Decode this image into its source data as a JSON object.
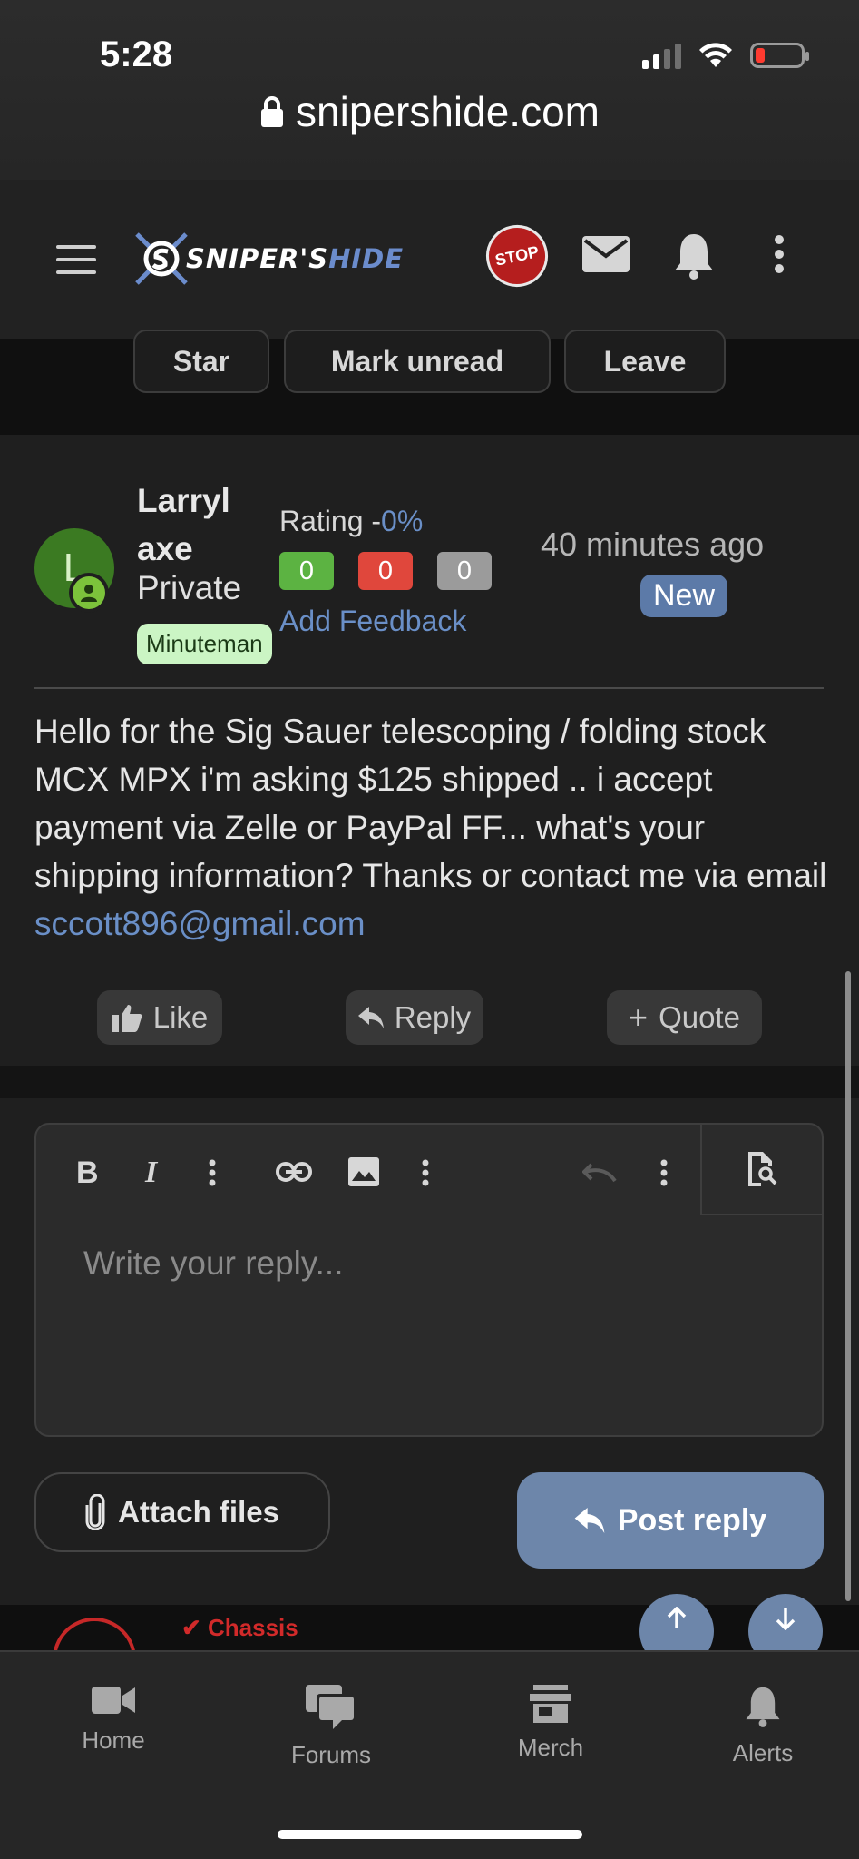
{
  "status_bar": {
    "time": "5:28"
  },
  "browser": {
    "url": "snipershide.com"
  },
  "header": {
    "logo_main": "SNIPER'S",
    "logo_accent": "HIDE",
    "stop_sign": "STOP"
  },
  "thread_actions": [
    {
      "label": "Star"
    },
    {
      "label": "Mark unread"
    },
    {
      "label": "Leave"
    }
  ],
  "post": {
    "avatar_letter": "L",
    "username": "Larryl axe",
    "user_title": "Private",
    "user_badge": "Minuteman",
    "rating_label": "Rating -",
    "rating_value": "0%",
    "rating_positive": "0",
    "rating_negative": "0",
    "rating_neutral": "0",
    "add_feedback": "Add Feedback",
    "time": "40 minutes ago",
    "new_badge": "New",
    "body_text": "Hello for the Sig Sauer telescoping / folding stock MCX MPX i'm asking $125 shipped .. i accept payment via Zelle or PayPal FF... what's your shipping information? Thanks or contact me via email ",
    "email": "sccott896@gmail.com",
    "like_label": "Like",
    "reply_label": "Reply",
    "quote_label": "Quote"
  },
  "reply_editor": {
    "placeholder": "Write your reply...",
    "bold": "B",
    "italic": "I",
    "attach_label": "Attach files",
    "post_reply_label": "Post reply"
  },
  "ad": {
    "text": "✔ Chassis"
  },
  "bottom_nav": [
    {
      "label": "Home",
      "icon": "video-camera-icon"
    },
    {
      "label": "Forums",
      "icon": "chat-bubbles-icon"
    },
    {
      "label": "Merch",
      "icon": "store-icon"
    },
    {
      "label": "Alerts",
      "icon": "bell-icon"
    }
  ],
  "colors": {
    "accent": "#6a8fc7",
    "button": "#6d86aa",
    "rating_positive": "#5cb342",
    "rating_negative": "#e0473c",
    "rating_neutral": "#9b9b9b"
  }
}
